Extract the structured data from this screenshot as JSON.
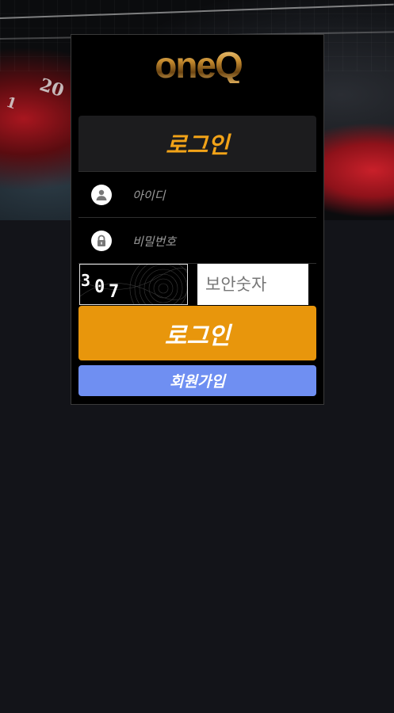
{
  "brand": {
    "logo_text": "oneQ"
  },
  "login_form": {
    "title": "로그인",
    "username": {
      "placeholder": "아이디",
      "value": ""
    },
    "password": {
      "placeholder": "비밀번호",
      "value": ""
    },
    "captcha": {
      "digits": [
        "3",
        "0",
        "7"
      ],
      "input_placeholder": "보안숫자",
      "input_value": ""
    },
    "login_button": "로그인",
    "register_button": "회원가입"
  },
  "colors": {
    "page_background": "#131419",
    "panel_background": "#000000",
    "title_accent": "#f2a318",
    "login_button": "#e8960c",
    "register_button": "#6f8ff2"
  },
  "icons": {
    "username": "user-icon",
    "password": "lock-icon"
  }
}
